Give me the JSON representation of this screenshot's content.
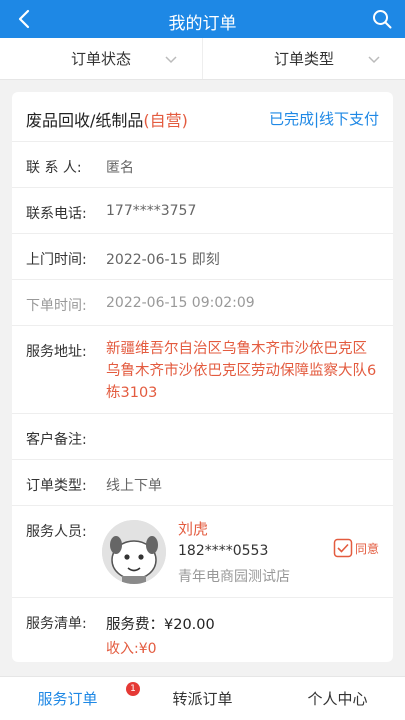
{
  "header": {
    "title": "我的订单",
    "back_icon": "chevron-left-icon",
    "search_icon": "search-icon"
  },
  "filters": [
    {
      "label": "订单状态"
    },
    {
      "label": "订单类型"
    }
  ],
  "order": {
    "category": "废品回收/纸制品",
    "self_run": "(自营)",
    "status": "已完成|线下支付",
    "contact": {
      "label": "联 系 人:",
      "value": "匿名"
    },
    "phone": {
      "label": "联系电话:",
      "value": "177****3757"
    },
    "visit_time": {
      "label": "上门时间:",
      "value": "2022-06-15 即刻"
    },
    "order_time": {
      "label": "下单时间:",
      "value": "2022-06-15 09:02:09"
    },
    "address": {
      "label": "服务地址:",
      "value": "新疆维吾尔自治区乌鲁木齐市沙依巴克区乌鲁木齐市沙依巴克区劳动保障监察大队6栋3103"
    },
    "remark": {
      "label": "客户备注:",
      "value": ""
    },
    "order_type": {
      "label": "订单类型:",
      "value": "线上下单"
    },
    "staff": {
      "label": "服务人员:",
      "name": "刘虎",
      "phone": "182****0553",
      "store": "青年电商园测试店",
      "agree": "同意"
    },
    "service_list": {
      "label": "服务清单:",
      "fee": "服务费：¥20.00",
      "income": "收入:¥0"
    }
  },
  "tabs": [
    {
      "label": "服务订单",
      "badge": "1"
    },
    {
      "label": "转派订单"
    },
    {
      "label": "个人中心"
    }
  ],
  "colors": {
    "primary": "#1e88e5",
    "accent": "#e35b3f",
    "badge": "#e53935"
  }
}
